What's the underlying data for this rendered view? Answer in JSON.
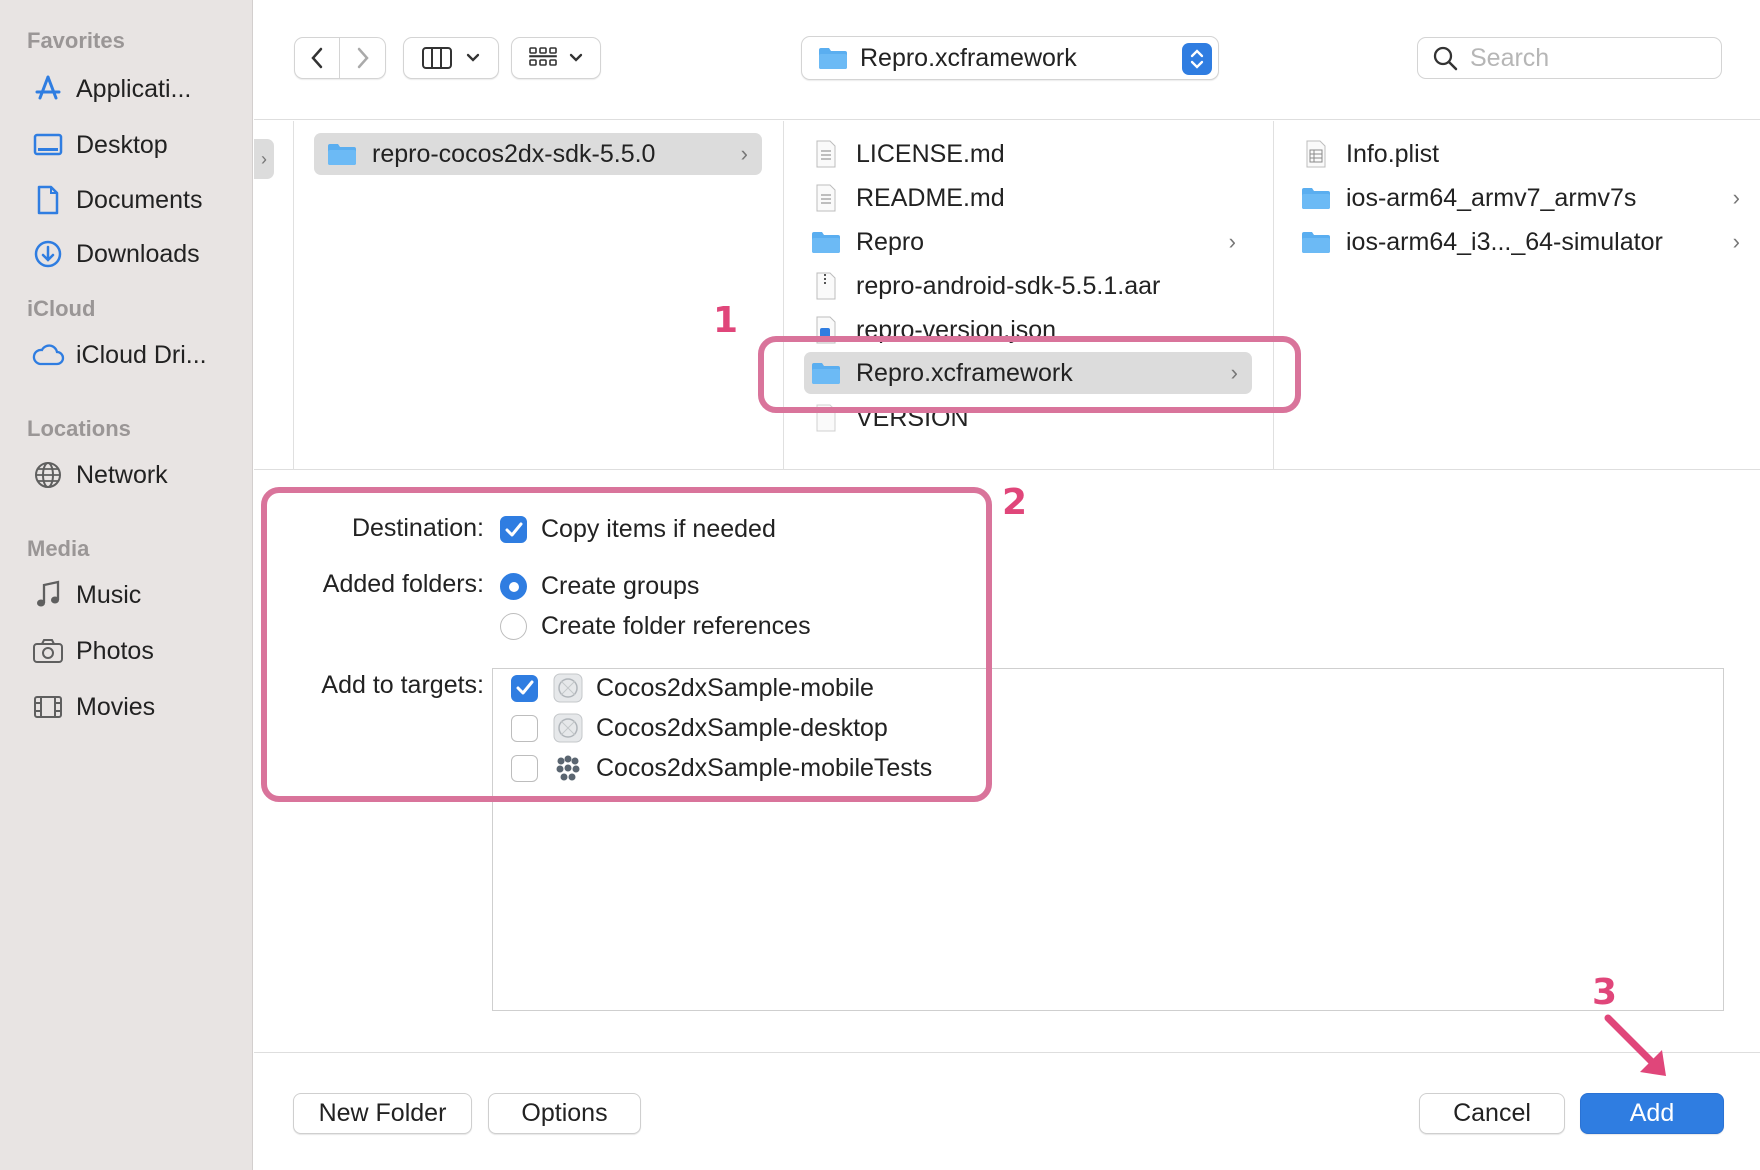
{
  "sidebar": {
    "sections": [
      {
        "title": "Favorites",
        "items": [
          {
            "label": "Applicati...",
            "icon": "applications-icon"
          },
          {
            "label": "Desktop",
            "icon": "desktop-icon"
          },
          {
            "label": "Documents",
            "icon": "document-icon"
          },
          {
            "label": "Downloads",
            "icon": "downloads-icon"
          }
        ]
      },
      {
        "title": "iCloud",
        "items": [
          {
            "label": "iCloud Dri...",
            "icon": "cloud-icon"
          }
        ]
      },
      {
        "title": "Locations",
        "items": [
          {
            "label": "Network",
            "icon": "globe-icon"
          }
        ]
      },
      {
        "title": "Media",
        "items": [
          {
            "label": "Music",
            "icon": "music-note-icon"
          },
          {
            "label": "Photos",
            "icon": "camera-icon"
          },
          {
            "label": "Movies",
            "icon": "film-icon"
          }
        ]
      }
    ]
  },
  "toolbar": {
    "path_label": "Repro.xcframework",
    "search_placeholder": "Search"
  },
  "browser": {
    "col1": [
      {
        "label": "repro-cocos2dx-sdk-5.5.0",
        "type": "folder",
        "selected": true
      }
    ],
    "col2": [
      {
        "label": "LICENSE.md",
        "type": "text-file"
      },
      {
        "label": "README.md",
        "type": "text-file"
      },
      {
        "label": "Repro",
        "type": "folder"
      },
      {
        "label": "repro-android-sdk-5.5.1.aar",
        "type": "archive-file"
      },
      {
        "label": "repro-version.json",
        "type": "json-file"
      },
      {
        "label": "Repro.xcframework",
        "type": "folder",
        "selected": true
      },
      {
        "label": "VERSION",
        "type": "blank-file"
      }
    ],
    "col3": [
      {
        "label": "Info.plist",
        "type": "plist-file"
      },
      {
        "label": "ios-arm64_armv7_armv7s",
        "type": "folder"
      },
      {
        "label": "ios-arm64_i3..._64-simulator",
        "type": "folder"
      }
    ]
  },
  "options": {
    "destination_label": "Destination:",
    "copy_items_label": "Copy items if needed",
    "copy_items_checked": true,
    "added_folders_label": "Added folders:",
    "create_groups_label": "Create groups",
    "create_groups_selected": true,
    "create_folder_refs_label": "Create folder references",
    "add_to_targets_label": "Add to targets:",
    "targets": [
      {
        "label": "Cocos2dxSample-mobile",
        "checked": true,
        "icon": "app-target-icon"
      },
      {
        "label": "Cocos2dxSample-desktop",
        "checked": false,
        "icon": "app-target-icon"
      },
      {
        "label": "Cocos2dxSample-mobileTests",
        "checked": false,
        "icon": "test-bundle-icon"
      }
    ]
  },
  "buttons": {
    "new_folder": "New Folder",
    "options": "Options",
    "cancel": "Cancel",
    "add": "Add"
  },
  "annotations": {
    "step1": "1",
    "step2": "2",
    "step3": "3",
    "color": "#d9749b"
  },
  "colors": {
    "accent": "#2f7de1",
    "sidebar_bg": "#e8e4e3",
    "selection_bg": "#dcdcdc"
  }
}
